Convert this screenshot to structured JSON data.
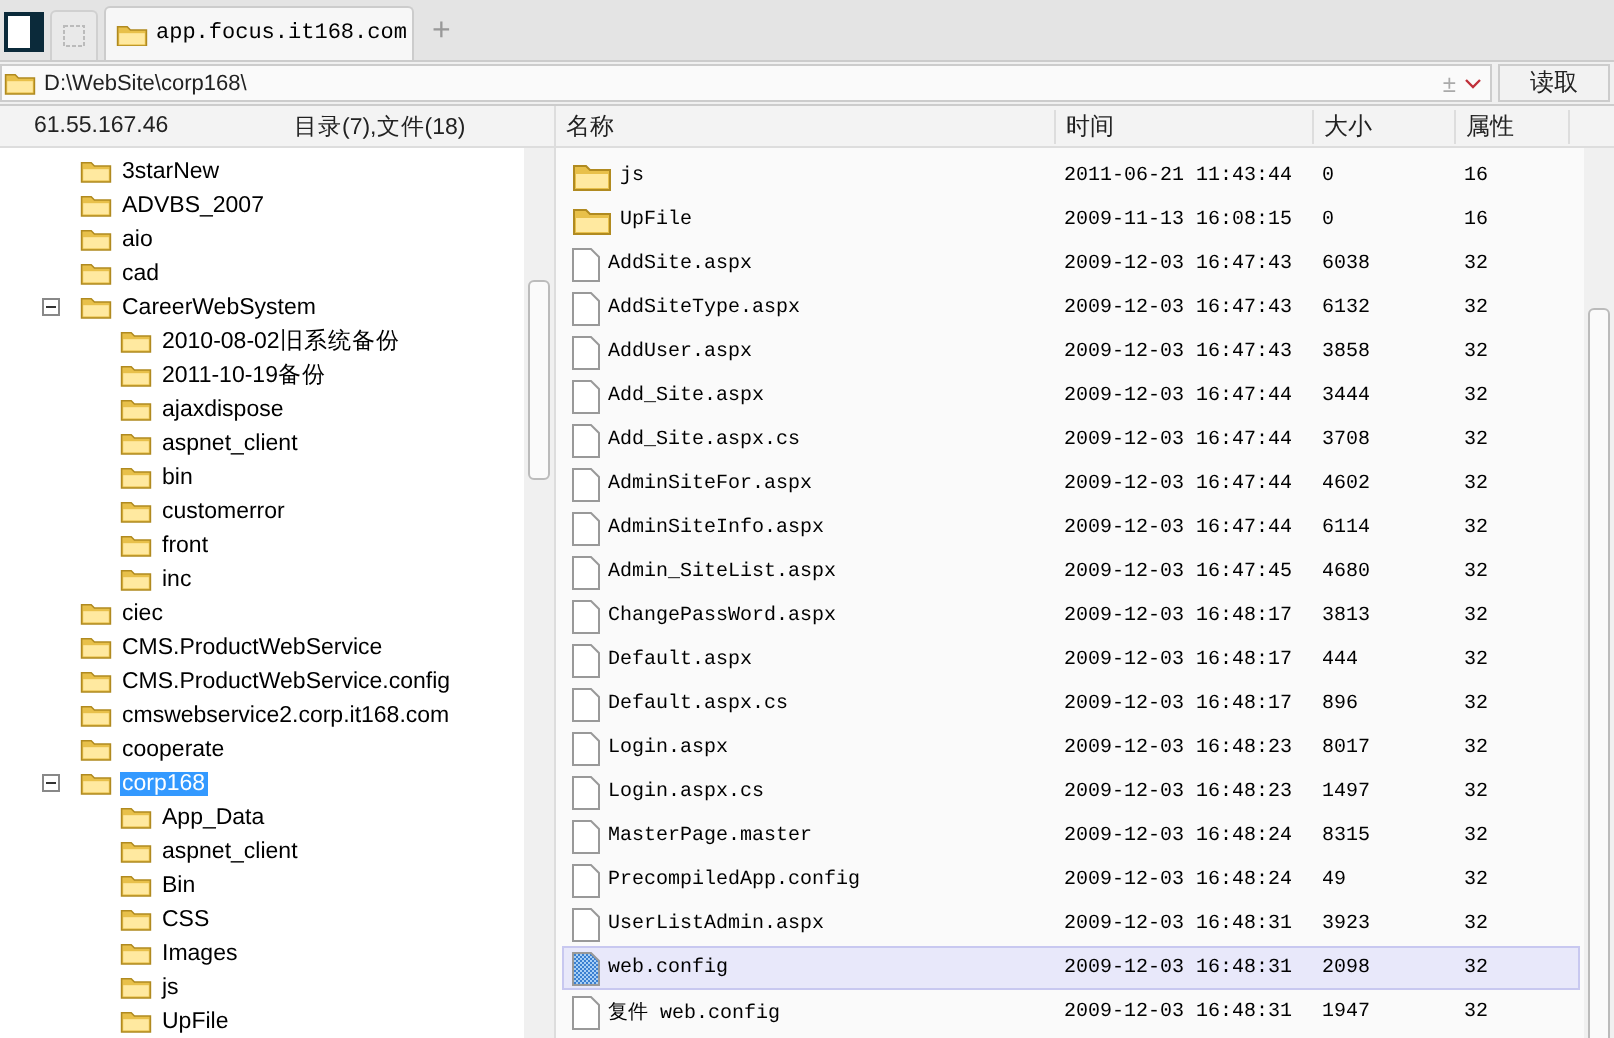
{
  "tabs": [
    {
      "label": "app.focus.it168.com",
      "selected": true
    }
  ],
  "new_tab": "+",
  "path_bar": {
    "value": "D:\\WebSite\\corp168\\",
    "toggle": "±",
    "read_button": "读取"
  },
  "left_header": {
    "host": "61.55.167.46",
    "summary": "目录(7),文件(18)"
  },
  "tree": [
    {
      "label": "3starNew",
      "selected": false
    },
    {
      "label": "ADVBS_2007",
      "selected": false
    },
    {
      "label": "aio",
      "selected": false
    },
    {
      "label": "cad",
      "selected": false
    },
    {
      "label": "CareerWebSystem",
      "selected": false,
      "expanded": true,
      "children": [
        {
          "label": "2010-08-02旧系统备份",
          "selected": false
        },
        {
          "label": "2011-10-19备份",
          "selected": false
        },
        {
          "label": "ajaxdispose",
          "selected": false
        },
        {
          "label": "aspnet_client",
          "selected": false
        },
        {
          "label": "bin",
          "selected": false
        },
        {
          "label": "customerror",
          "selected": false
        },
        {
          "label": "front",
          "selected": false
        },
        {
          "label": "inc",
          "selected": false
        }
      ]
    },
    {
      "label": "ciec",
      "selected": false
    },
    {
      "label": "CMS.ProductWebService",
      "selected": false
    },
    {
      "label": "CMS.ProductWebService.config",
      "selected": false
    },
    {
      "label": "cmswebservice2.corp.it168.com",
      "selected": false
    },
    {
      "label": "cooperate",
      "selected": false
    },
    {
      "label": "corp168",
      "selected": true,
      "expanded": true,
      "children": [
        {
          "label": "App_Data",
          "selected": false
        },
        {
          "label": "aspnet_client",
          "selected": false
        },
        {
          "label": "Bin",
          "selected": false
        },
        {
          "label": "CSS",
          "selected": false
        },
        {
          "label": "Images",
          "selected": false
        },
        {
          "label": "js",
          "selected": false
        },
        {
          "label": "UpFile",
          "selected": false
        }
      ]
    }
  ],
  "table": {
    "columns": [
      "名称",
      "时间",
      "大小",
      "属性"
    ],
    "rows": [
      {
        "kind": "folder",
        "selected": false,
        "cells": [
          "js",
          "2011-06-21 11:43:44",
          "0",
          "16"
        ]
      },
      {
        "kind": "folder",
        "selected": false,
        "cells": [
          "UpFile",
          "2009-11-13 16:08:15",
          "0",
          "16"
        ]
      },
      {
        "kind": "file",
        "selected": false,
        "cells": [
          "AddSite.aspx",
          "2009-12-03 16:47:43",
          "6038",
          "32"
        ]
      },
      {
        "kind": "file",
        "selected": false,
        "cells": [
          "AddSiteType.aspx",
          "2009-12-03 16:47:43",
          "6132",
          "32"
        ]
      },
      {
        "kind": "file",
        "selected": false,
        "cells": [
          "AddUser.aspx",
          "2009-12-03 16:47:43",
          "3858",
          "32"
        ]
      },
      {
        "kind": "file",
        "selected": false,
        "cells": [
          "Add_Site.aspx",
          "2009-12-03 16:47:44",
          "3444",
          "32"
        ]
      },
      {
        "kind": "file",
        "selected": false,
        "cells": [
          "Add_Site.aspx.cs",
          "2009-12-03 16:47:44",
          "3708",
          "32"
        ]
      },
      {
        "kind": "file",
        "selected": false,
        "cells": [
          "AdminSiteFor.aspx",
          "2009-12-03 16:47:44",
          "4602",
          "32"
        ]
      },
      {
        "kind": "file",
        "selected": false,
        "cells": [
          "AdminSiteInfo.aspx",
          "2009-12-03 16:47:44",
          "6114",
          "32"
        ]
      },
      {
        "kind": "file",
        "selected": false,
        "cells": [
          "Admin_SiteList.aspx",
          "2009-12-03 16:47:45",
          "4680",
          "32"
        ]
      },
      {
        "kind": "file",
        "selected": false,
        "cells": [
          "ChangePassWord.aspx",
          "2009-12-03 16:48:17",
          "3813",
          "32"
        ]
      },
      {
        "kind": "file",
        "selected": false,
        "cells": [
          "Default.aspx",
          "2009-12-03 16:48:17",
          "444",
          "32"
        ]
      },
      {
        "kind": "file",
        "selected": false,
        "cells": [
          "Default.aspx.cs",
          "2009-12-03 16:48:17",
          "896",
          "32"
        ]
      },
      {
        "kind": "file",
        "selected": false,
        "cells": [
          "Login.aspx",
          "2009-12-03 16:48:23",
          "8017",
          "32"
        ]
      },
      {
        "kind": "file",
        "selected": false,
        "cells": [
          "Login.aspx.cs",
          "2009-12-03 16:48:23",
          "1497",
          "32"
        ]
      },
      {
        "kind": "file",
        "selected": false,
        "cells": [
          "MasterPage.master",
          "2009-12-03 16:48:24",
          "8315",
          "32"
        ]
      },
      {
        "kind": "file",
        "selected": false,
        "cells": [
          "PrecompiledApp.config",
          "2009-12-03 16:48:24",
          "49",
          "32"
        ]
      },
      {
        "kind": "file",
        "selected": false,
        "cells": [
          "UserListAdmin.aspx",
          "2009-12-03 16:48:31",
          "3923",
          "32"
        ]
      },
      {
        "kind": "config",
        "selected": true,
        "cells": [
          "web.config",
          "2009-12-03 16:48:31",
          "2098",
          "32"
        ]
      },
      {
        "kind": "file",
        "selected": false,
        "cells": [
          "复件 web.config",
          "2009-12-03 16:48:31",
          "1947",
          "32"
        ]
      }
    ]
  }
}
